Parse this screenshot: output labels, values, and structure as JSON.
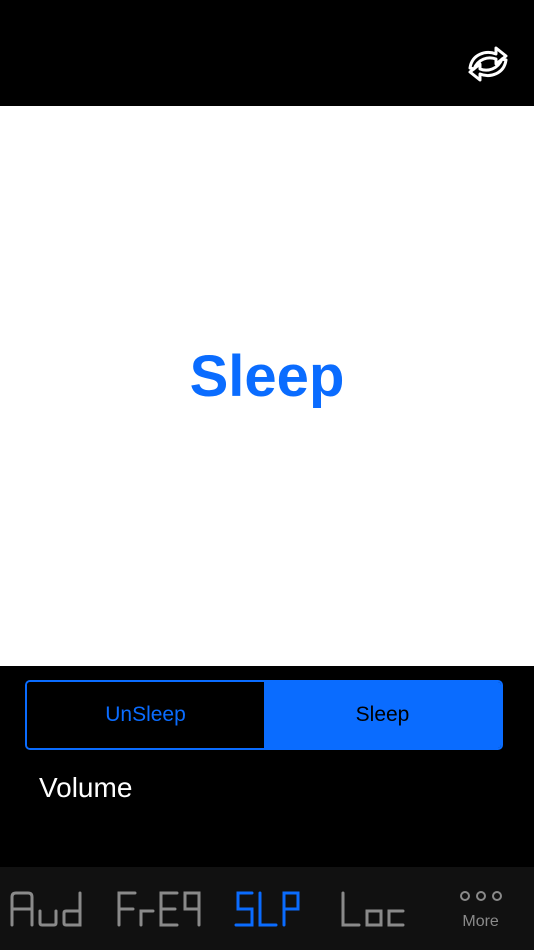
{
  "header": {
    "sync_icon": "sync-arrows-icon"
  },
  "status": {
    "title": "Sleep",
    "color": "#0A6CFF"
  },
  "segmented": {
    "options": [
      {
        "label": "UnSleep",
        "selected": false
      },
      {
        "label": "Sleep",
        "selected": true
      }
    ]
  },
  "volume": {
    "label": "Volume"
  },
  "tabbar": {
    "tabs": [
      {
        "text": "Aud",
        "active": false
      },
      {
        "text": "FrEq",
        "active": false
      },
      {
        "text": "SLP",
        "active": true
      },
      {
        "text": "Loc",
        "active": false
      }
    ],
    "more": {
      "label": "More",
      "icon": "more-dots-icon"
    },
    "active_color": "#0A6CFF",
    "inactive_color": "#8a8a8a"
  }
}
